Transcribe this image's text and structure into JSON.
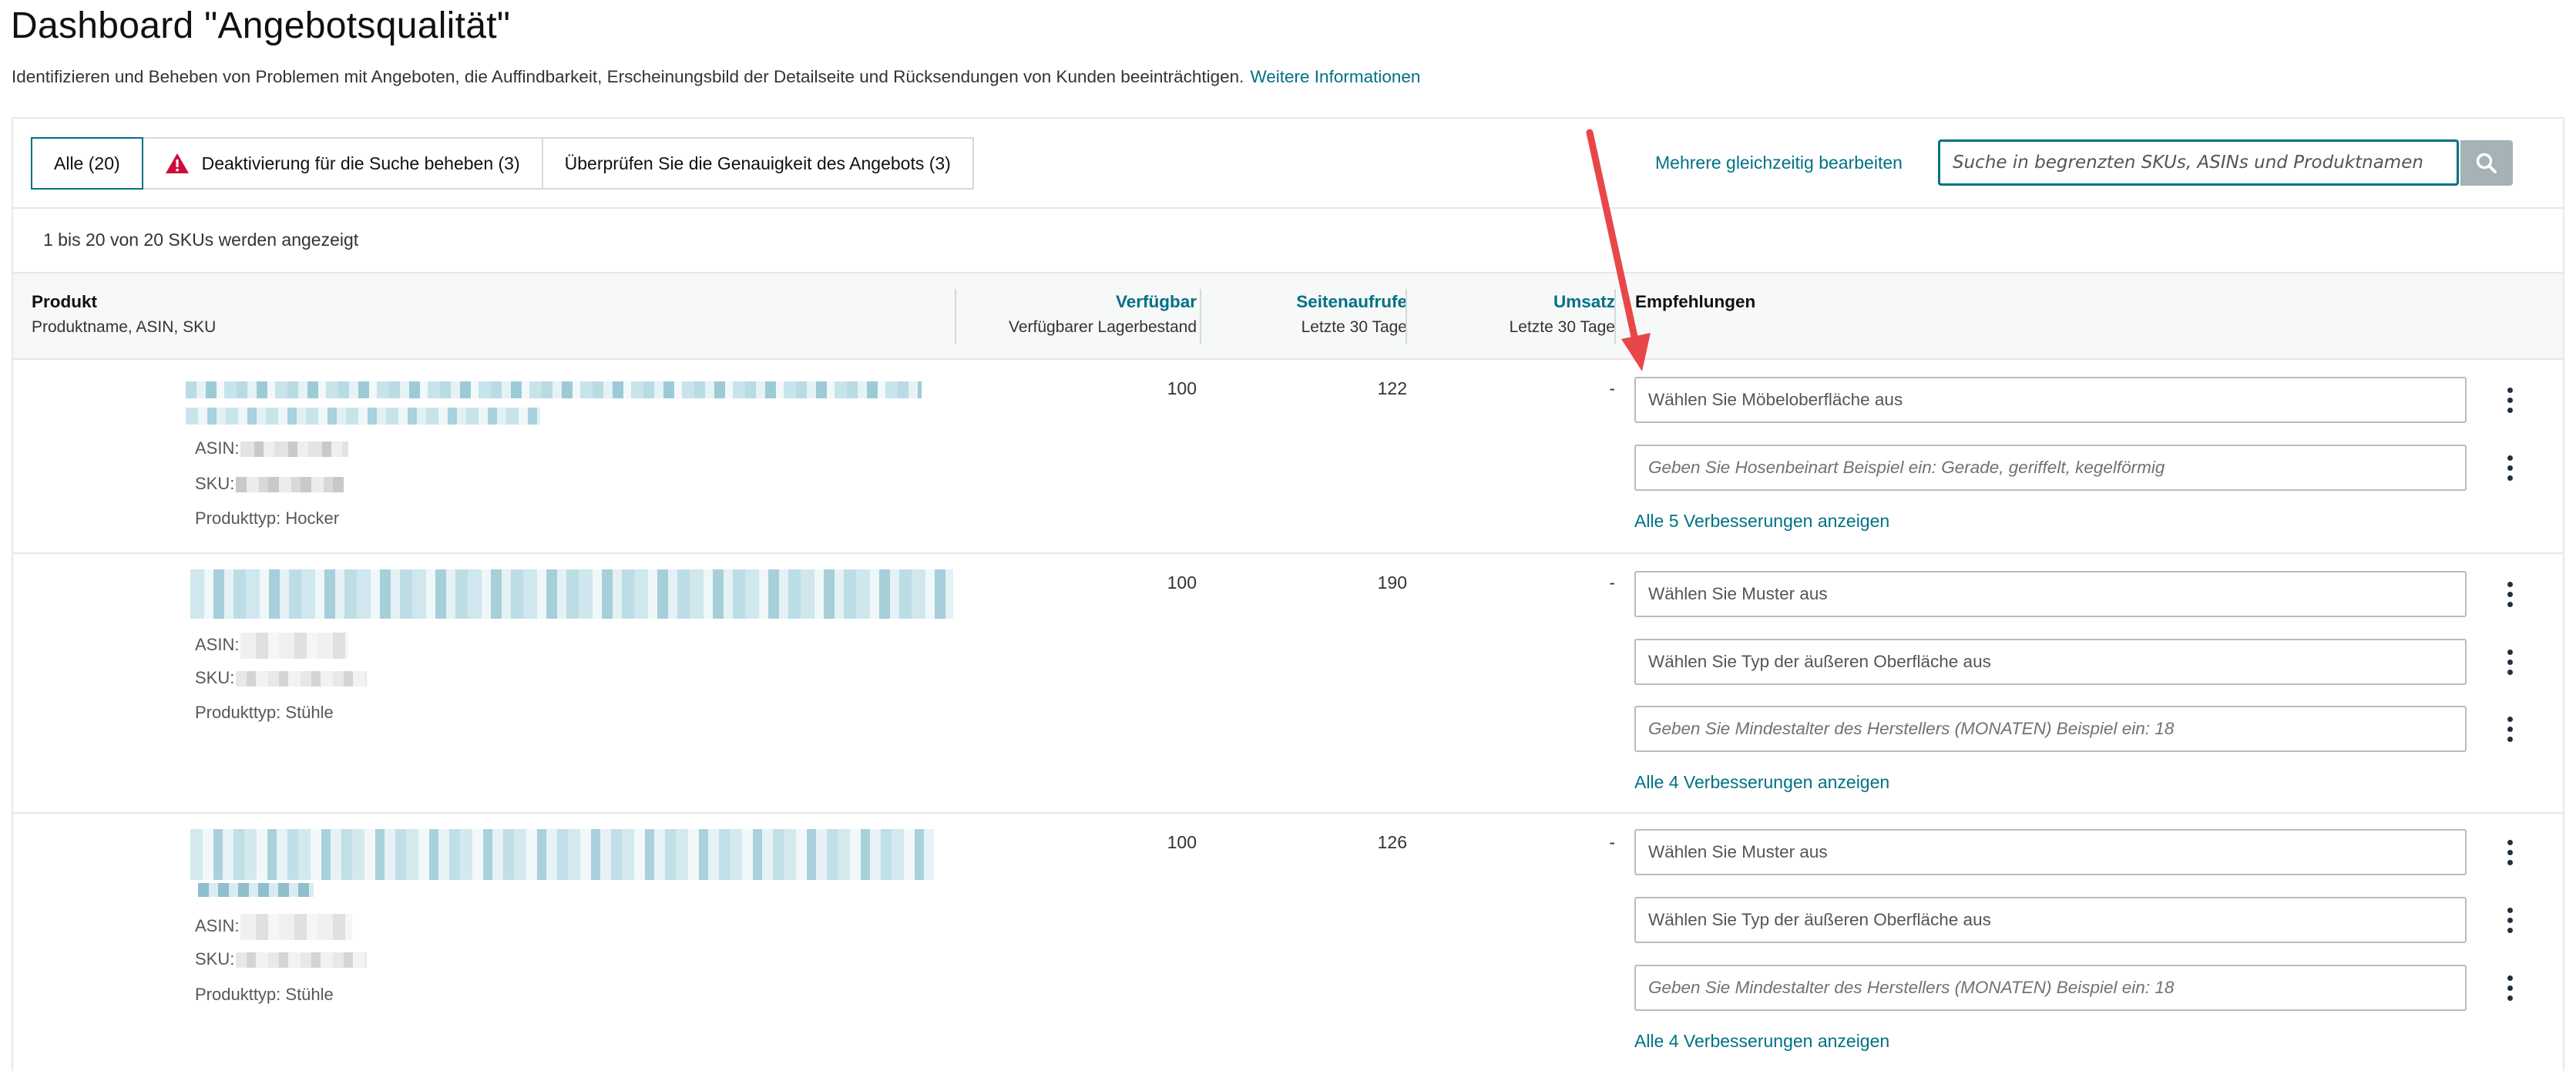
{
  "page": {
    "title": "Dashboard \"Angebotsqualität\"",
    "description": "Identifizieren und Beheben von Problemen mit Angeboten, die Auffindbarkeit, Erscheinungsbild der Detailseite und Rücksendungen von Kunden beeinträchtigen.",
    "more_info_link": "Weitere Informationen"
  },
  "tabs": [
    {
      "label": "Alle (20)",
      "active": true
    },
    {
      "label": "Deaktivierung für die Suche beheben (3)",
      "icon": "warning-icon"
    },
    {
      "label": "Überprüfen Sie die Genauigkeit des Angebots (3)"
    }
  ],
  "toolbar": {
    "multi_edit": "Mehrere gleichzeitig bearbeiten",
    "search_placeholder": "Suche in begrenzten SKUs, ASINs und Produktnamen",
    "search_icon": "search-icon"
  },
  "count_text": "1 bis 20 von 20 SKUs werden angezeigt",
  "columns": {
    "product": {
      "title": "Produkt",
      "sub": "Produktname, ASIN, SKU"
    },
    "available": {
      "title": "Verfügbar",
      "sub": "Verfügbarer Lagerbestand"
    },
    "pageviews": {
      "title": "Seitenaufrufe",
      "sub": "Letzte 30 Tage"
    },
    "sales": {
      "title": "Umsatz",
      "sub": "Letzte 30 Tage"
    },
    "recommendations": {
      "title": "Empfehlungen"
    }
  },
  "labels": {
    "asin": "ASIN:",
    "sku": "SKU:"
  },
  "rows": [
    {
      "product_type": "Produkttyp: Hocker",
      "available": "100",
      "pageviews": "122",
      "sales": "-",
      "recommendations": [
        {
          "text": "Wählen Sie Möbeloberfläche aus",
          "italic": false
        },
        {
          "text": "Geben Sie Hosenbeinart Beispiel ein: Gerade, geriffelt, kegelförmig",
          "italic": true
        }
      ],
      "show_all": "Alle 5 Verbesserungen anzeigen"
    },
    {
      "product_type": "Produkttyp: Stühle",
      "available": "100",
      "pageviews": "190",
      "sales": "-",
      "recommendations": [
        {
          "text": "Wählen Sie Muster aus",
          "italic": false
        },
        {
          "text": "Wählen Sie Typ der äußeren Oberfläche aus",
          "italic": false
        },
        {
          "text": "Geben Sie Mindestalter des Herstellers (MONATEN) Beispiel ein: 18",
          "italic": true
        }
      ],
      "show_all": "Alle 4 Verbesserungen anzeigen"
    },
    {
      "product_type": "Produkttyp: Stühle",
      "available": "100",
      "pageviews": "126",
      "sales": "-",
      "recommendations": [
        {
          "text": "Wählen Sie Muster aus",
          "italic": false
        },
        {
          "text": "Wählen Sie Typ der äußeren Oberfläche aus",
          "italic": false
        },
        {
          "text": "Geben Sie Mindestalter des Herstellers (MONATEN) Beispiel ein: 18",
          "italic": true
        }
      ],
      "show_all": "Alle 4 Verbesserungen anzeigen"
    }
  ],
  "colors": {
    "link": "#007185",
    "annotation_arrow": "#e8474a",
    "warning": "#cc0c39"
  }
}
